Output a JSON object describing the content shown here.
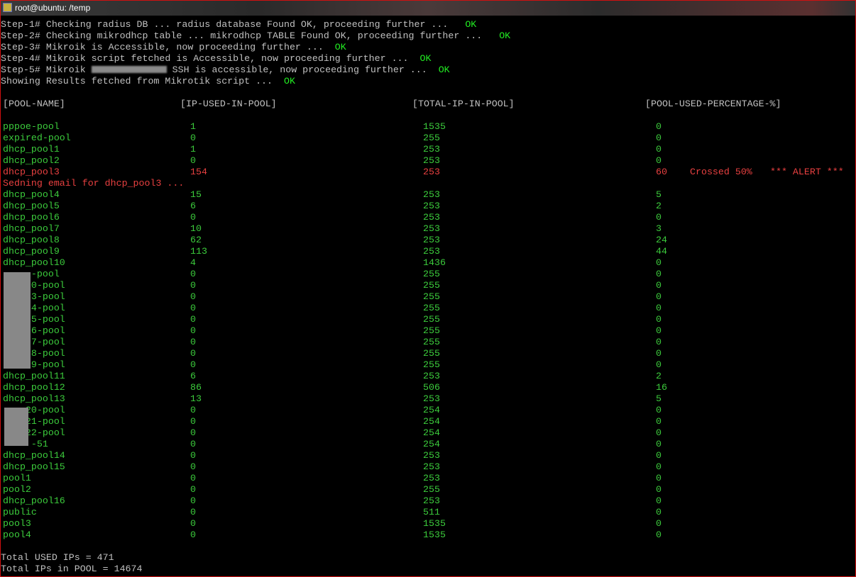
{
  "window": {
    "title": "root@ubuntu: /temp"
  },
  "steps": [
    {
      "text": "Step-1# Checking radius DB ... radius database Found OK, proceeding further ...   ",
      "status": "OK"
    },
    {
      "text": "Step-2# Checking mikrodhcp table ... mikrodhcp TABLE Found OK, proceeding further ...   ",
      "status": "OK"
    },
    {
      "text": "Step-3# Mikroik is Accessible, now proceeding further ...  ",
      "status": "OK"
    },
    {
      "text": "Step-4# Mikroik script fetched is Accessible, now proceeding further ...  ",
      "status": "OK"
    },
    {
      "text_a": "Step-5# Mikroik ",
      "text_b": " SSH is accessible, now proceeding further ...  ",
      "status": "OK"
    },
    {
      "text": "Showing Results fetched from Mikrotik script ...  ",
      "status": "OK"
    }
  ],
  "headers": [
    "[POOL-NAME]",
    "[IP-USED-IN-POOL]",
    "[TOTAL-IP-IN-POOL]",
    "[POOL-USED-PERCENTAGE-%]"
  ],
  "rows": [
    {
      "name": "pppoe-pool",
      "used": "1",
      "total": "1535",
      "pct": "0"
    },
    {
      "name": "expired-pool",
      "used": "0",
      "total": "255",
      "pct": "0"
    },
    {
      "name": "dhcp_pool1",
      "used": "1",
      "total": "253",
      "pct": "0"
    },
    {
      "name": "dhcp_pool2",
      "used": "0",
      "total": "253",
      "pct": "0"
    },
    {
      "name": "dhcp_pool3",
      "used": "154",
      "total": "253",
      "pct": "60",
      "alert": "Crossed 50%",
      "alert2": "*** ALERT ***"
    },
    {
      "message": "Sedning email for dhcp_pool3 ..."
    },
    {
      "name": "dhcp_pool4",
      "used": "15",
      "total": "253",
      "pct": "5"
    },
    {
      "name": "dhcp_pool5",
      "used": "6",
      "total": "253",
      "pct": "2"
    },
    {
      "name": "dhcp_pool6",
      "used": "0",
      "total": "253",
      "pct": "0"
    },
    {
      "name": "dhcp_pool7",
      "used": "10",
      "total": "253",
      "pct": "3"
    },
    {
      "name": "dhcp_pool8",
      "used": "62",
      "total": "253",
      "pct": "24"
    },
    {
      "name": "dhcp_pool9",
      "used": "113",
      "total": "253",
      "pct": "44"
    },
    {
      "name": "dhcp_pool10",
      "used": "4",
      "total": "1436",
      "pct": "0"
    },
    {
      "name": "     -pool",
      "used": "0",
      "total": "255",
      "pct": "0"
    },
    {
      "name": "     0-pool",
      "used": "0",
      "total": "255",
      "pct": "0"
    },
    {
      "name": "     3-pool",
      "used": "0",
      "total": "255",
      "pct": "0"
    },
    {
      "name": "     4-pool",
      "used": "0",
      "total": "255",
      "pct": "0"
    },
    {
      "name": "     5-pool",
      "used": "0",
      "total": "255",
      "pct": "0"
    },
    {
      "name": "     6-pool",
      "used": "0",
      "total": "255",
      "pct": "0"
    },
    {
      "name": "     7-pool",
      "used": "0",
      "total": "255",
      "pct": "0"
    },
    {
      "name": "     8-pool",
      "used": "0",
      "total": "255",
      "pct": "0"
    },
    {
      "name": "     9-pool",
      "used": "0",
      "total": "255",
      "pct": "0"
    },
    {
      "name": "dhcp_pool11",
      "used": "6",
      "total": "253",
      "pct": "2"
    },
    {
      "name": "dhcp_pool12",
      "used": "86",
      "total": "506",
      "pct": "16"
    },
    {
      "name": "dhcp_pool13",
      "used": "13",
      "total": "253",
      "pct": "5"
    },
    {
      "name": "    20-pool",
      "used": "0",
      "total": "254",
      "pct": "0"
    },
    {
      "name": "    21-pool",
      "used": "0",
      "total": "254",
      "pct": "0"
    },
    {
      "name": "    22-pool",
      "used": "0",
      "total": "254",
      "pct": "0"
    },
    {
      "name": "     -51",
      "used": "0",
      "total": "254",
      "pct": "0"
    },
    {
      "name": "dhcp_pool14",
      "used": "0",
      "total": "253",
      "pct": "0"
    },
    {
      "name": "dhcp_pool15",
      "used": "0",
      "total": "253",
      "pct": "0"
    },
    {
      "name": "pool1",
      "used": "0",
      "total": "253",
      "pct": "0"
    },
    {
      "name": "pool2",
      "used": "0",
      "total": "255",
      "pct": "0"
    },
    {
      "name": "dhcp_pool16",
      "used": "0",
      "total": "253",
      "pct": "0"
    },
    {
      "name": "public",
      "used": "0",
      "total": "511",
      "pct": "0"
    },
    {
      "name": "pool3",
      "used": "0",
      "total": "1535",
      "pct": "0"
    },
    {
      "name": "pool4",
      "used": "0",
      "total": "1535",
      "pct": "0"
    }
  ],
  "totals": {
    "used": "Total USED IPs = 471",
    "pool": "Total IPs in POOL = 14674"
  },
  "colors": {
    "ok": "#22ee22",
    "row": "#3ccc3c",
    "alert": "#e84040",
    "text": "#c0c0c0"
  }
}
